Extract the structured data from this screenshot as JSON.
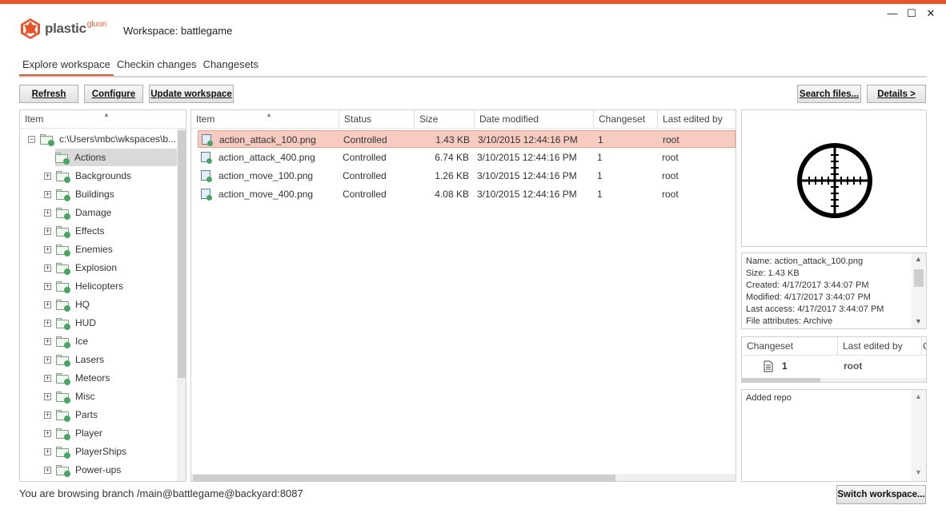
{
  "window": {
    "accent": "#e8552b",
    "minimize_glyph": "—",
    "maximize_glyph": "☐",
    "close_glyph": "✕"
  },
  "header": {
    "logo_text": "plastic",
    "logo_sup": "gluon",
    "workspace_title": "Workspace: battlegame"
  },
  "tabs": [
    {
      "label": "Explore workspace",
      "active": true
    },
    {
      "label": "Checkin changes",
      "active": false
    },
    {
      "label": "Changesets",
      "active": false
    }
  ],
  "toolbar": {
    "refresh": "Refresh",
    "configure": "Configure",
    "update_workspace": "Update workspace",
    "search_files": "Search files...",
    "details": "Details >"
  },
  "tree": {
    "header": "Item",
    "root": "c:\\Users\\mbc\\wkspaces\\b...",
    "items": [
      {
        "label": "Actions",
        "selected": true
      },
      {
        "label": "Backgrounds"
      },
      {
        "label": "Buildings"
      },
      {
        "label": "Damage"
      },
      {
        "label": "Effects"
      },
      {
        "label": "Enemies"
      },
      {
        "label": "Explosion"
      },
      {
        "label": "Helicopters"
      },
      {
        "label": "HQ"
      },
      {
        "label": "HUD"
      },
      {
        "label": "Ice"
      },
      {
        "label": "Lasers"
      },
      {
        "label": "Meteors"
      },
      {
        "label": "Misc"
      },
      {
        "label": "Parts"
      },
      {
        "label": "Player"
      },
      {
        "label": "PlayerShips"
      },
      {
        "label": "Power-ups"
      }
    ]
  },
  "files": {
    "columns": [
      "Item",
      "Status",
      "Size",
      "Date modified",
      "Changeset",
      "Last edited by"
    ],
    "rows": [
      {
        "item": "action_attack_100.png",
        "status": "Controlled",
        "size": "1.43 KB",
        "date": "3/10/2015 12:44:16 PM",
        "changeset": "1",
        "by": "root",
        "selected": true
      },
      {
        "item": "action_attack_400.png",
        "status": "Controlled",
        "size": "6.74 KB",
        "date": "3/10/2015 12:44:16 PM",
        "changeset": "1",
        "by": "root"
      },
      {
        "item": "action_move_100.png",
        "status": "Controlled",
        "size": "1.26 KB",
        "date": "3/10/2015 12:44:16 PM",
        "changeset": "1",
        "by": "root"
      },
      {
        "item": "action_move_400.png",
        "status": "Controlled",
        "size": "4.08 KB",
        "date": "3/10/2015 12:44:16 PM",
        "changeset": "1",
        "by": "root"
      }
    ]
  },
  "details": {
    "info_lines": [
      "Name: action_attack_100.png",
      "Size: 1.43 KB",
      "Created: 4/17/2017 3:44:07 PM",
      "Modified: 4/17/2017 3:44:07 PM",
      "Last access: 4/17/2017 3:44:07 PM",
      "File attributes: Archive"
    ],
    "history_columns": [
      "Changeset",
      "Last edited by"
    ],
    "history_row": {
      "changeset": "1",
      "by": "root"
    },
    "comment": "Added repo"
  },
  "status_bar": {
    "text": "You are browsing branch /main@battlegame@backyard:8087",
    "switch_button": "Switch workspace..."
  }
}
